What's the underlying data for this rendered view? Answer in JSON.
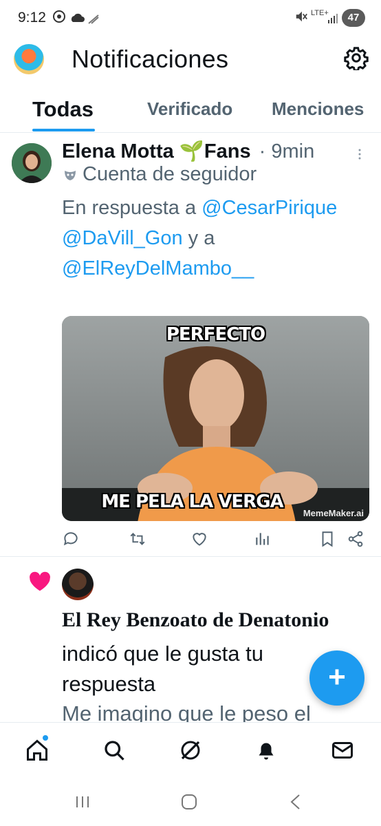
{
  "status_bar": {
    "time": "9:12",
    "network": "LTE+",
    "battery": "47",
    "icons": [
      "soccer-icon",
      "cloud-icon",
      "signal-icon",
      "mute-icon",
      "wifi-icon"
    ]
  },
  "header": {
    "title": "Notificaciones",
    "settings_icon": "gear-icon"
  },
  "tabs": [
    {
      "label": "Todas",
      "active": true
    },
    {
      "label": "Verificado",
      "active": false
    },
    {
      "label": "Menciones",
      "active": false
    }
  ],
  "tweet1": {
    "author_name": "Elena Motta 🌱Fans",
    "separator": "·",
    "time": "9min",
    "label_icon": "mask-icon",
    "label": "Cuenta de seguidor",
    "reply_prefix": "En respuesta a",
    "mention1": "@CesarPirique",
    "mention2": "@DaVill_Gon",
    "reply_and": "y a",
    "mention3": "@ElReyDelMambo__",
    "media": {
      "top_text": "PERFECTO",
      "bottom_text": "ME PELA LA VERGA",
      "watermark": "MemeMaker.ai"
    },
    "actions": [
      "reply-icon",
      "retweet-icon",
      "like-icon",
      "views-icon",
      "bookmark-icon",
      "share-icon"
    ]
  },
  "notification2": {
    "type_icon": "heart-icon",
    "author_name": "El Rey Benzoato de Denatonio",
    "text": "indicó que le gusta tu respuesta",
    "snippet": "Me imagino que le peso el"
  },
  "fab": {
    "label": "+"
  },
  "bottom_nav": [
    {
      "icon": "home-icon",
      "has_dot": true
    },
    {
      "icon": "search-icon"
    },
    {
      "icon": "grok-icon"
    },
    {
      "icon": "bell-icon",
      "active": true
    },
    {
      "icon": "mail-icon"
    }
  ],
  "colors": {
    "accent": "#1d9bf0",
    "text_primary": "#0f1419",
    "text_secondary": "#536471",
    "like": "#f91880"
  }
}
